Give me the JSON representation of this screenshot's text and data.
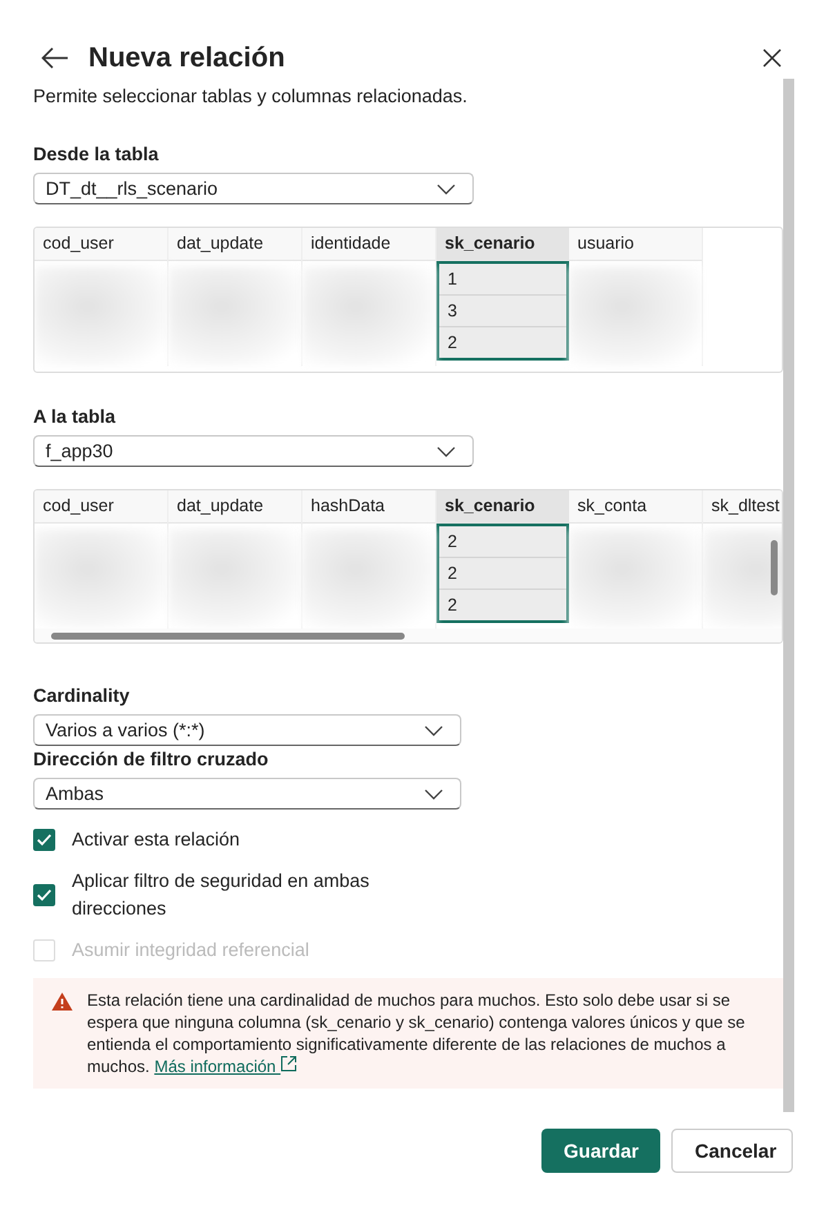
{
  "dialog": {
    "title": "Nueva relación",
    "subtitle": "Permite seleccionar tablas y columnas relacionadas."
  },
  "tables": [
    {
      "label": "Desde la tabla",
      "value": "DT_dt__rls_scenario",
      "kind": "plain",
      "columns": [
        {
          "name": "cod_user",
          "selected": false
        },
        {
          "name": "dat_update",
          "selected": false
        },
        {
          "name": "identidade",
          "selected": false
        },
        {
          "name": "sk_cenario",
          "selected": true
        },
        {
          "name": "usuario",
          "selected": false
        }
      ],
      "values": [
        "1",
        "3",
        "2"
      ]
    },
    {
      "label": "A la tabla",
      "value": "f_app30",
      "kind": "scrolling",
      "columns": [
        {
          "name": "cod_user",
          "selected": false
        },
        {
          "name": "dat_update",
          "selected": false
        },
        {
          "name": "hashData",
          "selected": false
        },
        {
          "name": "sk_cenario",
          "selected": true
        },
        {
          "name": "sk_conta",
          "selected": false
        },
        {
          "name": "sk_dltest",
          "selected": false
        }
      ],
      "values": [
        "2",
        "2",
        "2"
      ]
    }
  ],
  "selects": [
    {
      "label": "Cardinality",
      "value": "Varios a varios (*:*)"
    },
    {
      "label": "Dirección de filtro cruzado",
      "value": "Ambas"
    }
  ],
  "checkboxes": [
    {
      "label": "Activar esta relación",
      "checked": true,
      "disabled": false
    },
    {
      "label": "Aplicar filtro de seguridad en ambas direcciones",
      "checked": true,
      "disabled": false
    },
    {
      "label": "Asumir integridad referencial",
      "checked": false,
      "disabled": true
    }
  ],
  "warning": {
    "text": "Esta relación tiene una cardinalidad de muchos para muchos. Esto solo debe usar si se espera que ninguna columna (sk_cenario y sk_cenario) contenga valores únicos y que se entienda el comportamiento significativamente diferente de las relaciones de muchos a muchos.",
    "link": "Más información"
  },
  "buttons": [
    {
      "label": "Guardar",
      "kind": "primary"
    },
    {
      "label": "Cancelar",
      "kind": "secondary"
    }
  ]
}
